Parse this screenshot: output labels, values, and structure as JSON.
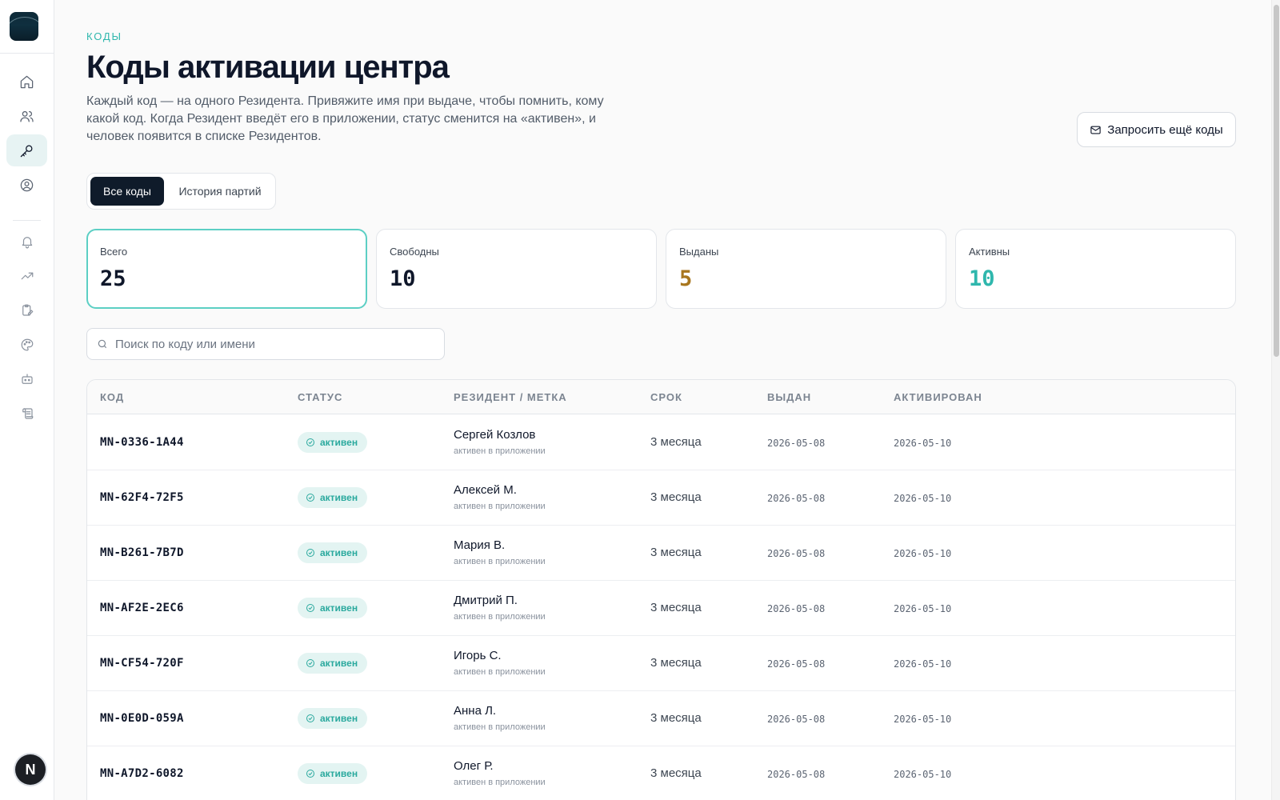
{
  "page": {
    "eyebrow": "КОДЫ",
    "title": "Коды активации центра",
    "description": "Каждый код — на одного Резидента. Привяжите имя при выдаче, чтобы помнить, кому какой код. Когда Резидент введёт его в приложении, статус сменится на «активен», и человек появится в списке Резидентов.",
    "request_button": "Запросить ещё коды"
  },
  "sidebar": {
    "icons": [
      "home-icon",
      "users-icon",
      "key-icon",
      "user-circle-icon",
      "bell-icon",
      "trending-up-icon",
      "clipboard-edit-icon",
      "palette-icon",
      "bot-icon",
      "scroll-icon"
    ],
    "active": "key-icon",
    "avatar_letter": "N"
  },
  "tabs": [
    {
      "label": "Все коды",
      "active": true
    },
    {
      "label": "История партий",
      "active": false
    }
  ],
  "stats": [
    {
      "label": "Всего",
      "value": "25",
      "color": "#0f172a",
      "selected": true
    },
    {
      "label": "Свободны",
      "value": "10",
      "color": "#0f172a",
      "selected": false
    },
    {
      "label": "Выданы",
      "value": "5",
      "color": "#a8761e",
      "selected": false
    },
    {
      "label": "Активны",
      "value": "10",
      "color": "#2fb7ad",
      "selected": false
    }
  ],
  "search": {
    "placeholder": "Поиск по коду или имени",
    "value": ""
  },
  "table": {
    "headers": [
      "КОД",
      "СТАТУС",
      "РЕЗИДЕНТ / МЕТКА",
      "СРОК",
      "ВЫДАН",
      "АКТИВИРОВАН"
    ],
    "rows": [
      {
        "code": "MN-0336-1A44",
        "status": "активен",
        "name": "Сергей Козлов",
        "note": "активен в приложении",
        "term": "3 месяца",
        "issued": "2026-05-08",
        "activated": "2026-05-10"
      },
      {
        "code": "MN-62F4-72F5",
        "status": "активен",
        "name": "Алексей М.",
        "note": "активен в приложении",
        "term": "3 месяца",
        "issued": "2026-05-08",
        "activated": "2026-05-10"
      },
      {
        "code": "MN-B261-7B7D",
        "status": "активен",
        "name": "Мария В.",
        "note": "активен в приложении",
        "term": "3 месяца",
        "issued": "2026-05-08",
        "activated": "2026-05-10"
      },
      {
        "code": "MN-AF2E-2EC6",
        "status": "активен",
        "name": "Дмитрий П.",
        "note": "активен в приложении",
        "term": "3 месяца",
        "issued": "2026-05-08",
        "activated": "2026-05-10"
      },
      {
        "code": "MN-CF54-720F",
        "status": "активен",
        "name": "Игорь С.",
        "note": "активен в приложении",
        "term": "3 месяца",
        "issued": "2026-05-08",
        "activated": "2026-05-10"
      },
      {
        "code": "MN-0E0D-059A",
        "status": "активен",
        "name": "Анна Л.",
        "note": "активен в приложении",
        "term": "3 месяца",
        "issued": "2026-05-08",
        "activated": "2026-05-10"
      },
      {
        "code": "MN-A7D2-6082",
        "status": "активен",
        "name": "Олег Р.",
        "note": "активен в приложении",
        "term": "3 месяца",
        "issued": "2026-05-08",
        "activated": "2026-05-10"
      }
    ]
  },
  "colors": {
    "accent": "#2fb7ad",
    "issued": "#a8761e",
    "dark": "#0f1b2a"
  }
}
